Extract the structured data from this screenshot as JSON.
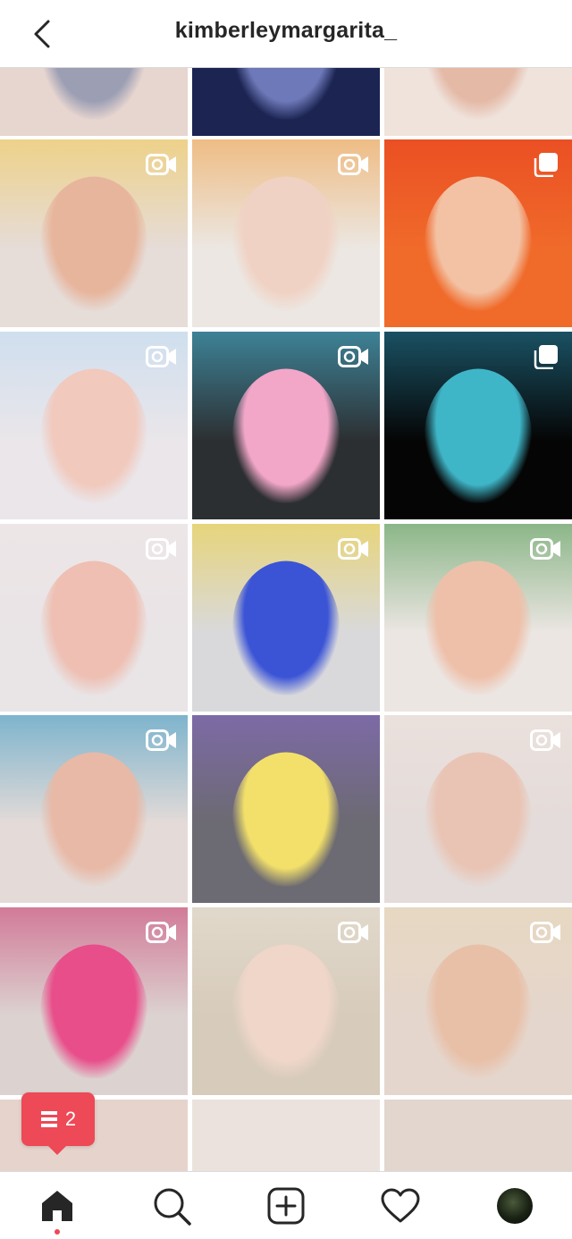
{
  "header": {
    "title": "kimberleymargarita_",
    "back_icon": "chevron-left-icon"
  },
  "grid": {
    "tiles": [
      {
        "row": 0,
        "col": 0,
        "badge": "none",
        "bg": "#e7d5cf",
        "accent": "#9c9fb4",
        "art": "#cfcfd8"
      },
      {
        "row": 0,
        "col": 1,
        "badge": "none",
        "bg": "#1c2452",
        "accent": "#6d79b8",
        "art": "#3a2f6e"
      },
      {
        "row": 0,
        "col": 2,
        "badge": "none",
        "bg": "#efe3dc",
        "accent": "#e4b9a6",
        "art": "#f3e8e2"
      },
      {
        "row": 1,
        "col": 0,
        "badge": "video",
        "bg": "#e6dcd8",
        "accent": "#e7b59c",
        "art": "#f4c94a"
      },
      {
        "row": 1,
        "col": 1,
        "badge": "video",
        "bg": "#ece7e2",
        "accent": "#f0d2c4",
        "art": "#f09a38"
      },
      {
        "row": 1,
        "col": 2,
        "badge": "carousel",
        "bg": "#f06a2a",
        "accent": "#f3c2a4",
        "art": "#e63a1e"
      },
      {
        "row": 2,
        "col": 0,
        "badge": "video",
        "bg": "#eae6ea",
        "accent": "#f1c9bd",
        "art": "#b9d9f2"
      },
      {
        "row": 2,
        "col": 1,
        "badge": "video",
        "bg": "#2c2f32",
        "accent": "#f2a6c8",
        "art": "#4bc6e8"
      },
      {
        "row": 2,
        "col": 2,
        "badge": "carousel",
        "bg": "#050505",
        "accent": "#3fb6c8",
        "art": "#2b8fb0"
      },
      {
        "row": 3,
        "col": 0,
        "badge": "video",
        "bg": "#e9e4e6",
        "accent": "#eebfb2",
        "art": "#f0e7e8"
      },
      {
        "row": 3,
        "col": 1,
        "badge": "video",
        "bg": "#d9d9dc",
        "accent": "#3b54d6",
        "art": "#f2d12c"
      },
      {
        "row": 3,
        "col": 2,
        "badge": "video",
        "bg": "#ece6e3",
        "accent": "#eec0a9",
        "art": "#3c8f3e"
      },
      {
        "row": 4,
        "col": 0,
        "badge": "video",
        "bg": "#e4dbd8",
        "accent": "#e8b9a6",
        "art": "#2a94c4"
      },
      {
        "row": 4,
        "col": 1,
        "badge": "none",
        "bg": "#6c6a72",
        "accent": "#f2e06a",
        "art": "#8a6ad0"
      },
      {
        "row": 4,
        "col": 2,
        "badge": "video",
        "bg": "#e4dcda",
        "accent": "#e9c4b4",
        "art": "#efe3dd"
      },
      {
        "row": 5,
        "col": 0,
        "badge": "video",
        "bg": "#dcd3d1",
        "accent": "#e84e8a",
        "art": "#c9326a"
      },
      {
        "row": 5,
        "col": 1,
        "badge": "video",
        "bg": "#d7cbbb",
        "accent": "#efd6c9",
        "art": "#e9e4d8"
      },
      {
        "row": 5,
        "col": 2,
        "badge": "video",
        "bg": "#e5d6cd",
        "accent": "#e8c0a8",
        "art": "#e8d9b8"
      },
      {
        "row": 6,
        "col": 0,
        "badge": "none",
        "bg": "#e6d4cc",
        "accent": "#e6d4cc",
        "art": "#e6d4cc"
      },
      {
        "row": 6,
        "col": 1,
        "badge": "none",
        "bg": "#ebe2dd",
        "accent": "#ebe2dd",
        "art": "#ebe2dd"
      },
      {
        "row": 6,
        "col": 2,
        "badge": "none",
        "bg": "#e3d6cf",
        "accent": "#e3d6cf",
        "art": "#e3d6cf"
      }
    ]
  },
  "notification": {
    "count": "2",
    "icon": "activity-list-icon"
  },
  "tabbar": {
    "items": [
      {
        "name": "home",
        "icon": "home-icon"
      },
      {
        "name": "search",
        "icon": "search-icon"
      },
      {
        "name": "create",
        "icon": "add-square-icon"
      },
      {
        "name": "activity",
        "icon": "heart-icon"
      },
      {
        "name": "profile",
        "icon": "profile-avatar-icon"
      }
    ]
  },
  "colors": {
    "notification": "#ed4956",
    "text": "#262626",
    "border": "#dbdbdb"
  }
}
